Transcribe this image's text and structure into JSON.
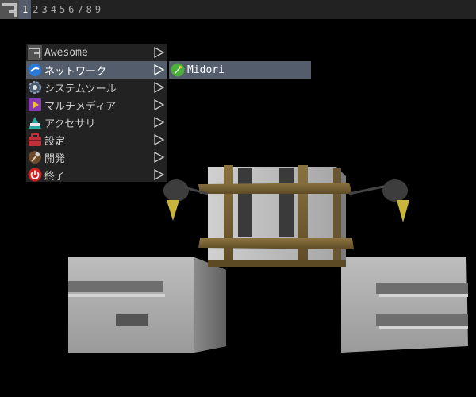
{
  "topbar": {
    "tags": [
      "1",
      "2",
      "3",
      "4",
      "5",
      "6",
      "7",
      "8",
      "9"
    ],
    "active_tag": "1"
  },
  "menu": {
    "items": [
      {
        "label": "Awesome",
        "icon": "awesome-icon",
        "has_submenu": true
      },
      {
        "label": "ネットワーク",
        "icon": "network-icon",
        "has_submenu": true,
        "active": true
      },
      {
        "label": "システムツール",
        "icon": "system-tools-icon",
        "has_submenu": true
      },
      {
        "label": "マルチメディア",
        "icon": "multimedia-icon",
        "has_submenu": true
      },
      {
        "label": "アクセサリ",
        "icon": "accessories-icon",
        "has_submenu": true
      },
      {
        "label": "設定",
        "icon": "settings-icon",
        "has_submenu": true
      },
      {
        "label": "開発",
        "icon": "development-icon",
        "has_submenu": true
      },
      {
        "label": "終了",
        "icon": "power-icon",
        "has_submenu": true
      }
    ],
    "submenu": [
      {
        "label": "Midori",
        "icon": "midori-icon",
        "active": true
      }
    ]
  },
  "colors": {
    "bar_bg": "#222222",
    "highlight": "#535d6c",
    "menu_text": "#cccccc",
    "desktop_bg": "#000000"
  }
}
